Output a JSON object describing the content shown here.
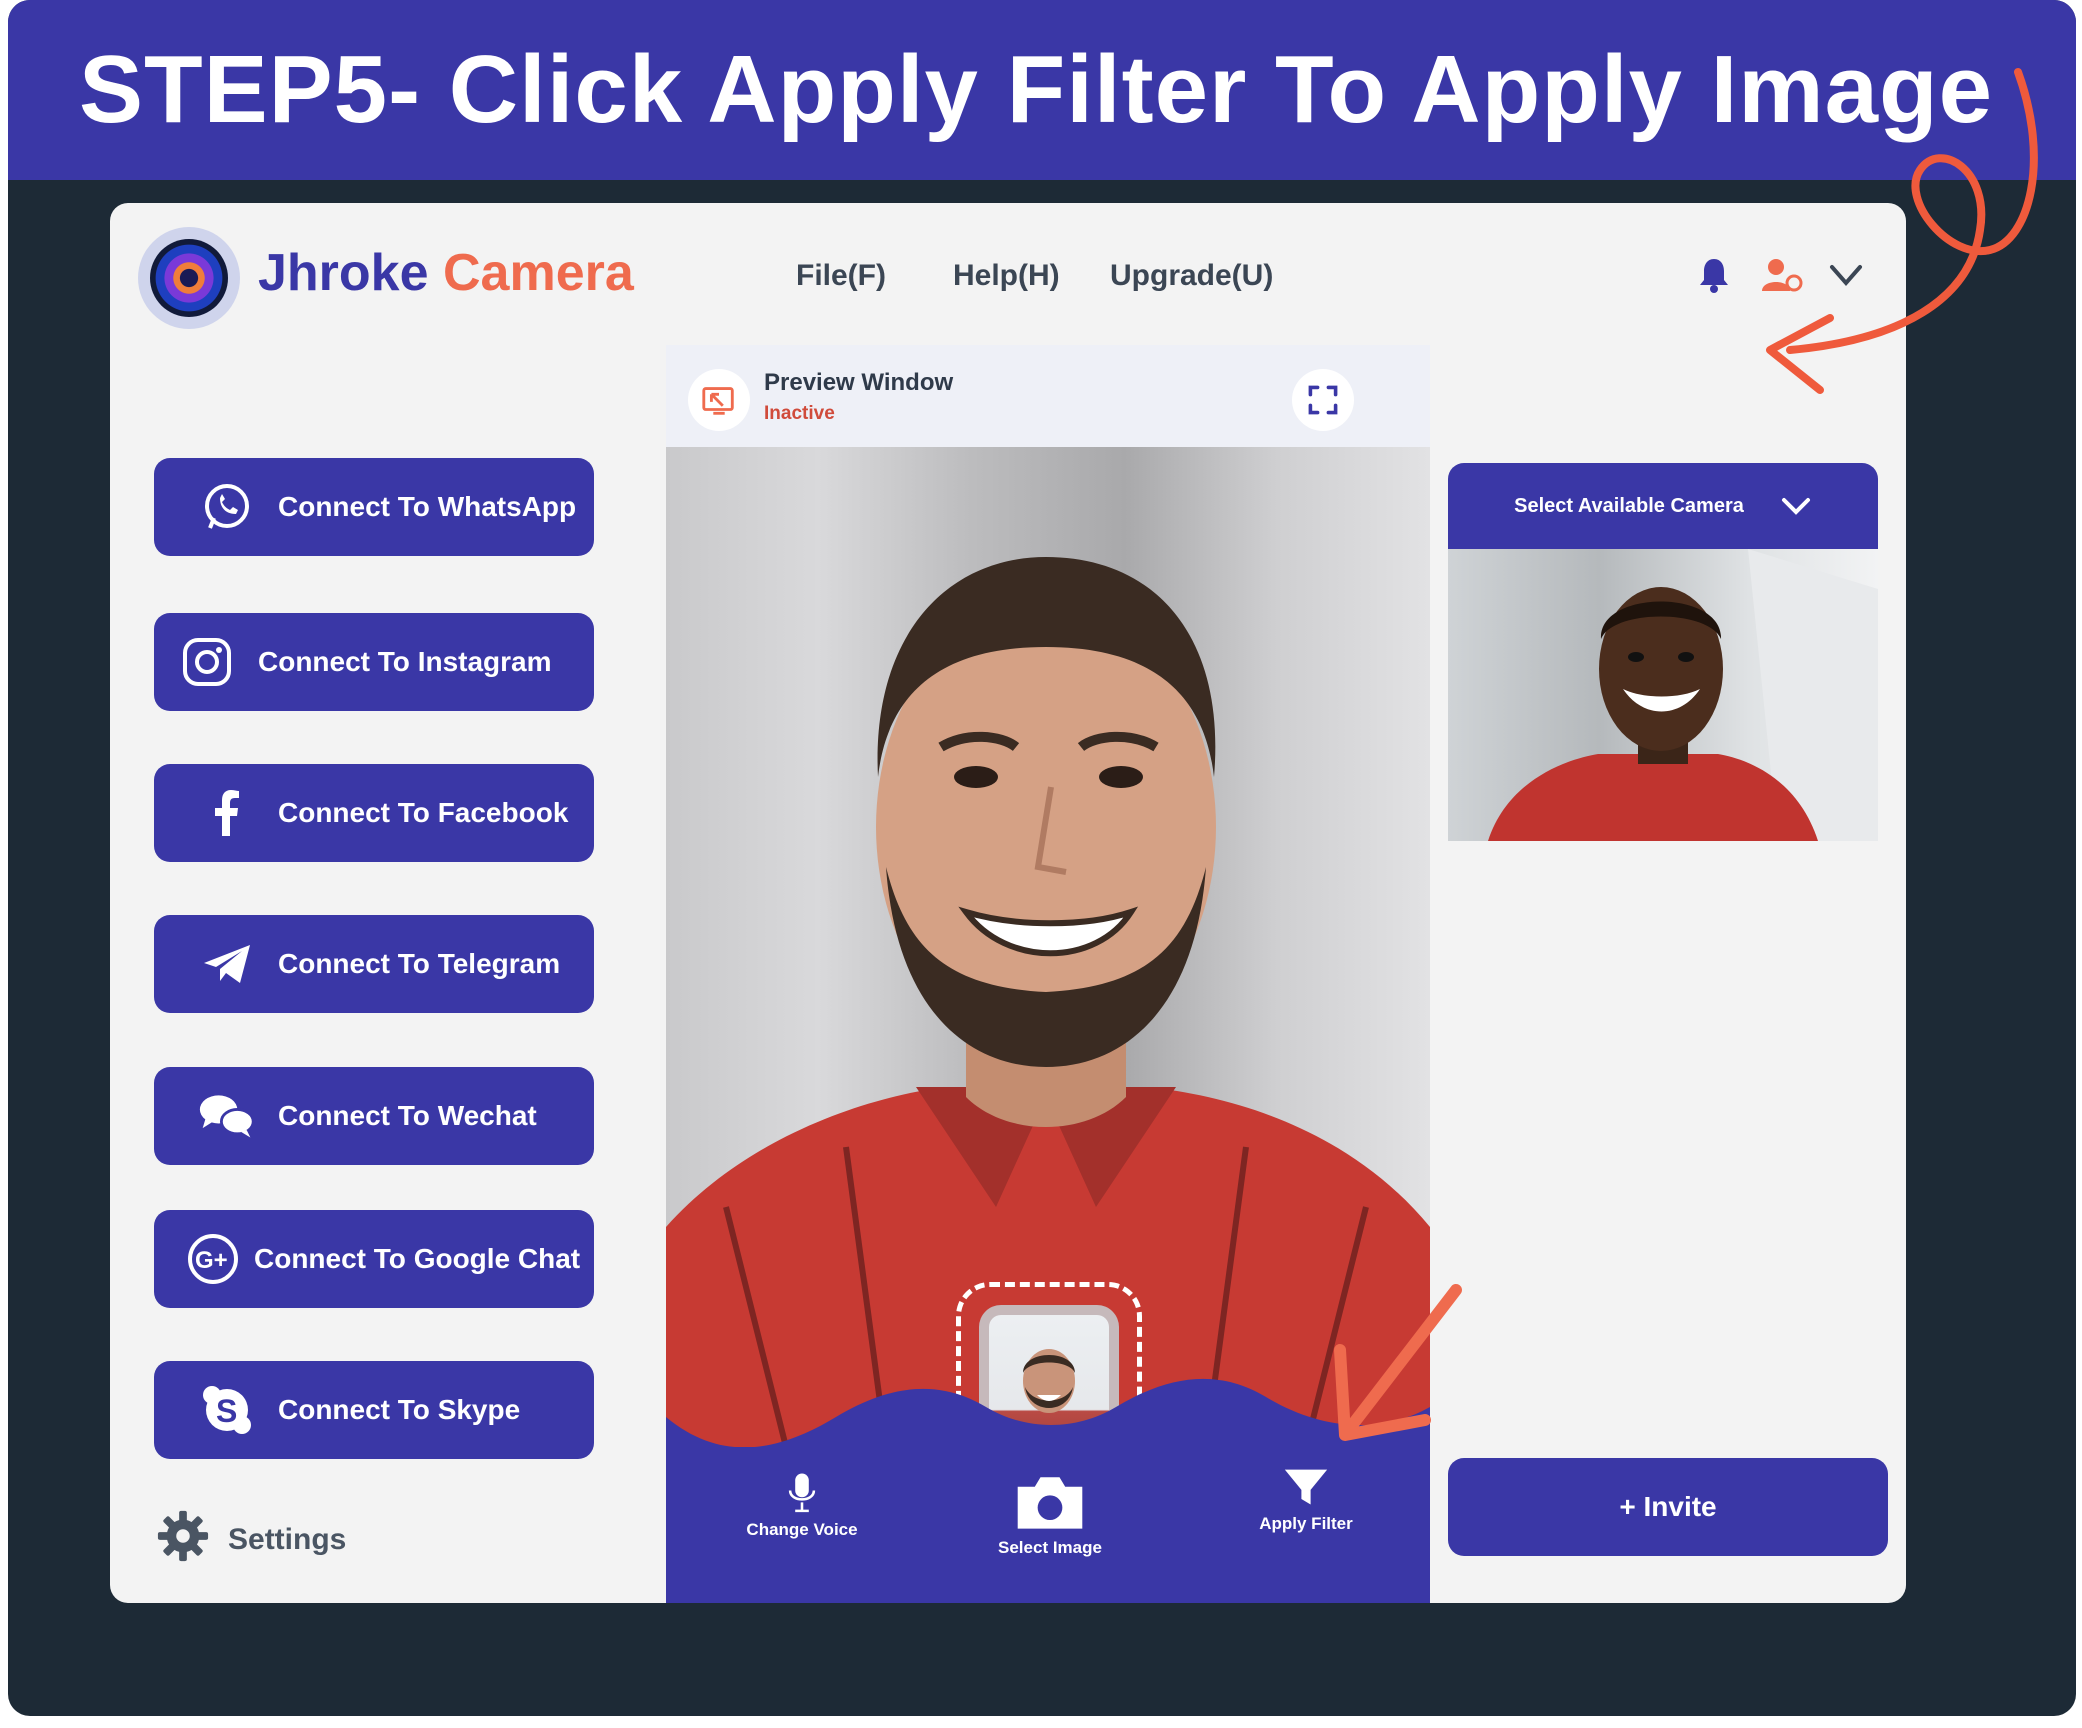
{
  "banner": {
    "title": "STEP5- Click Apply Filter To Apply Image"
  },
  "brand": {
    "part1": "Jhroke",
    "part2": "Camera"
  },
  "menu": {
    "file": "File(F)",
    "help": "Help(H)",
    "upgrade": "Upgrade(U)"
  },
  "sidebar": {
    "items": [
      {
        "label": "Connect To WhatsApp",
        "icon": "whatsapp-icon"
      },
      {
        "label": "Connect To Instagram",
        "icon": "instagram-icon"
      },
      {
        "label": "Connect To Facebook",
        "icon": "facebook-icon"
      },
      {
        "label": "Connect To Telegram",
        "icon": "telegram-icon"
      },
      {
        "label": "Connect To Wechat",
        "icon": "wechat-icon"
      },
      {
        "label": "Connect To Google Chat",
        "icon": "google-plus-icon"
      },
      {
        "label": "Connect To Skype",
        "icon": "skype-icon"
      }
    ],
    "settings_label": "Settings"
  },
  "preview": {
    "title": "Preview Window",
    "status": "Inactive",
    "actions": {
      "change_voice": "Change Voice",
      "select_image": "Select Image",
      "apply_filter": "Apply Filter"
    }
  },
  "camera": {
    "select_label": "Select Available Camera"
  },
  "invite": {
    "label": "+ Invite"
  },
  "colors": {
    "primary": "#3a37a6",
    "accent": "#ef6b4e",
    "frame": "#1d2a36",
    "panel": "#f3f3f3"
  }
}
